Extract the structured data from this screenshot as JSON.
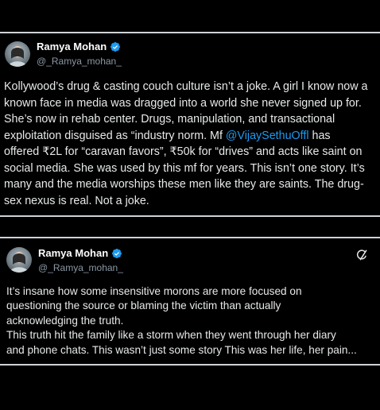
{
  "posts": [
    {
      "author": {
        "display_name": "Ramya Mohan",
        "handle": "@_Ramya_mohan_",
        "verified": true
      },
      "lines": [
        [
          "Kollywood’s drug & casting couch culture isn’t a joke. A girl I know now a"
        ],
        [
          "known face in media was dragged into a world she never signed up for."
        ],
        [
          "She’s now in  rehab center. Drugs, manipulation, and transactional"
        ],
        [
          "exploitation disguised as “industry norm. Mf ",
          "@VijaySethuOffl",
          " has"
        ],
        [
          "offered ₹2L for “caravan favors”, ₹50k for “drives” and acts like saint on"
        ],
        [
          "social media. She was used by this mf for years. This isn’t one story. It’s"
        ],
        [
          "many and the media worships these men like they are saints. The drug-"
        ],
        [
          "sex nexus is real. Not a joke."
        ]
      ]
    },
    {
      "author": {
        "display_name": "Ramya Mohan",
        "handle": "@_Ramya_mohan_",
        "verified": true
      },
      "lines": [
        [
          "It’s insane how some insensitive morons are more focused on"
        ],
        [
          "questioning the source or blaming the victim than actually"
        ],
        [
          "acknowledging the truth."
        ],
        [
          "This truth hit the family like a storm when they went through her diary"
        ],
        [
          "and phone chats. This wasn’t just some story This was her life, her pain..."
        ]
      ]
    }
  ],
  "icons": {
    "verified": "verified-badge-icon",
    "grok": "grok-icon"
  },
  "colors": {
    "background": "#000000",
    "text": "#e7e9ea",
    "secondary": "#8b98a5",
    "mention": "#1d9bf0",
    "verified": "#1d9bf0",
    "border": "#cfd3d6"
  }
}
